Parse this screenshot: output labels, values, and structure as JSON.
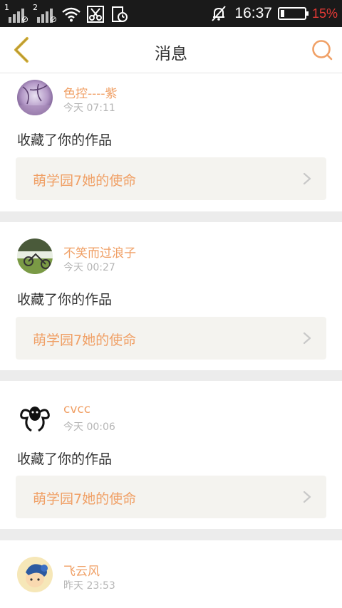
{
  "status_bar": {
    "sim1": "1",
    "sim2": "2",
    "time": "16:37",
    "battery_percent": "15%",
    "battery_level": 0.15,
    "icons": [
      "signal-icon",
      "signal-icon",
      "wifi-icon",
      "scissors-icon",
      "clipboard-clock-icon",
      "mute-bell-icon",
      "battery-icon"
    ]
  },
  "nav": {
    "title": "消息",
    "back_icon": "chevron-left-icon",
    "search_icon": "search-icon"
  },
  "colors": {
    "accent": "#f0a066",
    "back_icon": "#d4b13c"
  },
  "messages": [
    {
      "name": "色控----紫",
      "time": "今天 07:11",
      "action": "收藏了你的作品",
      "work_title": "萌学园7她的使命"
    },
    {
      "name": "不笑而过浪子",
      "time": "今天 00:27",
      "action": "收藏了你的作品",
      "work_title": "萌学园7她的使命"
    },
    {
      "name": "cvcc",
      "time": "今天 00:06",
      "action": "收藏了你的作品",
      "work_title": "萌学园7她的使命"
    },
    {
      "name": "飞云风",
      "time": "昨天 23:53",
      "action": "",
      "work_title": ""
    }
  ]
}
